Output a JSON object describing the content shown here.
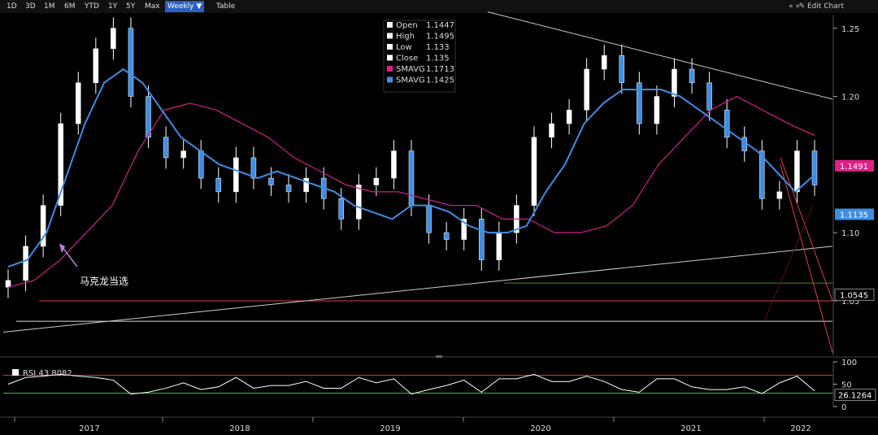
{
  "toolbar": {
    "buttons": [
      "1D",
      "3D",
      "1M",
      "6M",
      "YTD",
      "1Y",
      "5Y",
      "Max"
    ],
    "period_select": "Weekly ▼",
    "table_label": "Table",
    "nav_arrows": "«  »",
    "edit_chart": "✎ Edit Chart"
  },
  "colors": {
    "background": "#000000",
    "price_candles": "#ffffff",
    "sma_short": "#3d8ee6",
    "sma_long": "#d0208a",
    "rsi_line": "#ffffff",
    "rsi_70_line": "#e03030",
    "rsi_30_line": "#30c030",
    "support_line_red": "#e04040",
    "trend_lines": "#cccccc"
  },
  "legend": [
    {
      "label": "Open",
      "value": "1.1447",
      "color": "#ffffff"
    },
    {
      "label": "High",
      "value": "1.1495",
      "color": "#ffffff"
    },
    {
      "label": "Low",
      "value": "1.133",
      "color": "#ffffff"
    },
    {
      "label": "Close",
      "value": "1.135",
      "color": "#ffffff"
    },
    {
      "label": "SMAVG",
      "value": "1.1713",
      "color": "#e0208a"
    },
    {
      "label": "SMAVG",
      "value": "1.1425",
      "color": "#3d8ee6"
    }
  ],
  "annotation": "马克龙当选",
  "price_badges": [
    {
      "value": "1.1491",
      "color": "#e0208a",
      "text_color": "#ffffff"
    },
    {
      "value": "1.1135",
      "color": "#3d8ee6",
      "text_color": "#ffffff"
    },
    {
      "value": "1.0545",
      "color": "#000000",
      "text_color": "#ffffff"
    }
  ],
  "rsi_label": "RSI 43.8082",
  "rsi_badge": "26.1264",
  "chart_data": {
    "type": "line",
    "x_axis_labels": [
      "2017",
      "2018",
      "2019",
      "2020",
      "2021",
      "2022"
    ],
    "y_axis_ticks": [
      "1.25",
      "1.20",
      "1.10",
      "1.05"
    ],
    "ylim": [
      1.01,
      1.26
    ],
    "price_close": [
      1.065,
      1.09,
      1.12,
      1.18,
      1.21,
      1.235,
      1.25,
      1.2,
      1.17,
      1.155,
      1.16,
      1.14,
      1.13,
      1.155,
      1.14,
      1.135,
      1.13,
      1.14,
      1.125,
      1.11,
      1.135,
      1.14,
      1.16,
      1.12,
      1.1,
      1.095,
      1.11,
      1.08,
      1.1,
      1.12,
      1.17,
      1.18,
      1.19,
      1.22,
      1.23,
      1.21,
      1.18,
      1.2,
      1.22,
      1.21,
      1.19,
      1.17,
      1.16,
      1.125,
      1.13,
      1.16,
      1.135
    ],
    "series": [
      {
        "name": "SMAVG",
        "values": [
          1.075,
          1.08,
          1.1,
          1.14,
          1.18,
          1.21,
          1.22,
          1.21,
          1.19,
          1.17,
          1.16,
          1.15,
          1.145,
          1.14,
          1.145,
          1.14,
          1.135,
          1.13,
          1.12,
          1.115,
          1.11,
          1.12,
          1.12,
          1.115,
          1.105,
          1.1,
          1.1,
          1.105,
          1.13,
          1.15,
          1.18,
          1.195,
          1.205,
          1.205,
          1.205,
          1.2,
          1.19,
          1.18,
          1.17,
          1.16,
          1.145,
          1.13,
          1.1425
        ]
      },
      {
        "name": "SMAVG",
        "values": [
          1.06,
          1.065,
          1.08,
          1.1,
          1.12,
          1.16,
          1.19,
          1.195,
          1.19,
          1.18,
          1.17,
          1.155,
          1.145,
          1.135,
          1.13,
          1.13,
          1.125,
          1.12,
          1.12,
          1.11,
          1.11,
          1.1,
          1.1,
          1.105,
          1.12,
          1.15,
          1.17,
          1.19,
          1.2,
          1.19,
          1.18,
          1.1713
        ]
      }
    ],
    "rsi": {
      "ticks": [
        "100",
        "50",
        "0"
      ],
      "value": 43.8082,
      "overbought": 70,
      "oversold": 30
    },
    "grid": false
  }
}
